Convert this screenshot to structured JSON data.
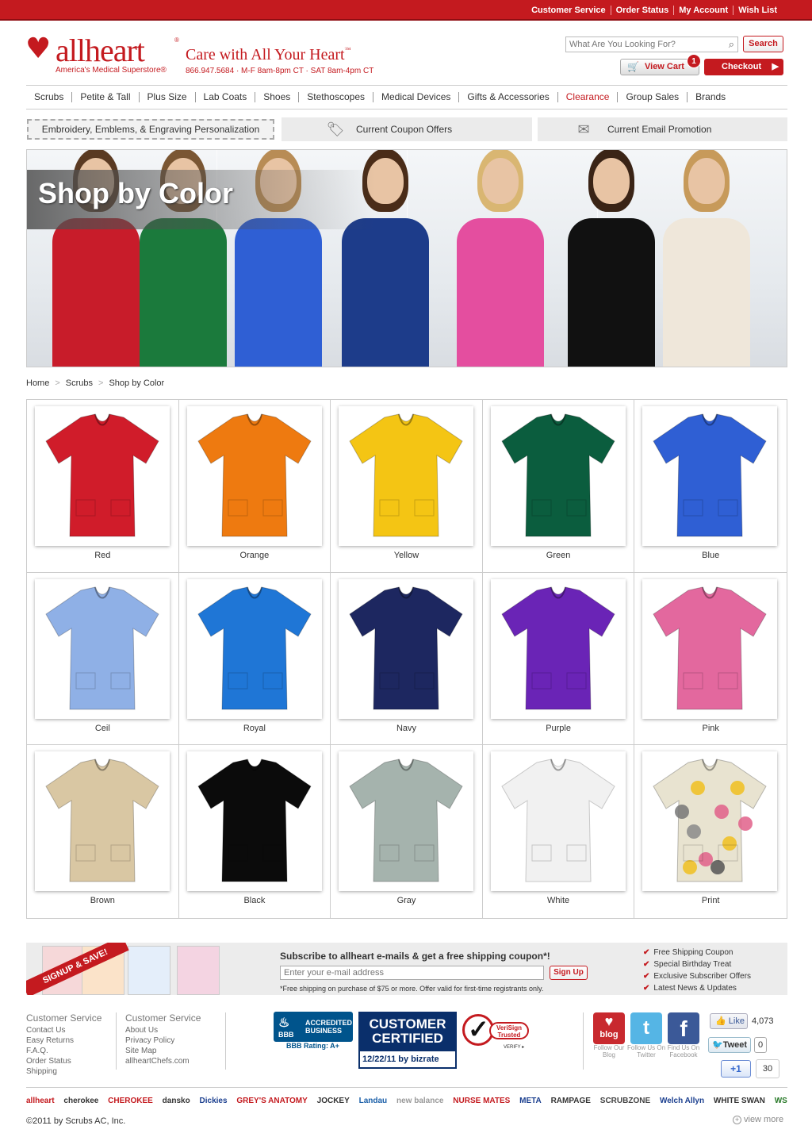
{
  "top_links": [
    "Customer Service",
    "Order Status",
    "My Account",
    "Wish List"
  ],
  "brand": {
    "name": "allheart",
    "reg": "®",
    "subtitle": "America's Medical Superstore",
    "reg2": "®",
    "tagline": "Care with All Your Heart",
    "tm": "™",
    "phone": "866.947.5684 · M-F 8am-8pm CT · SAT 8am-4pm CT"
  },
  "search": {
    "placeholder": "What Are You Looking For?",
    "button": "Search"
  },
  "cart": {
    "label": "View Cart",
    "count": "1",
    "checkout": "Checkout"
  },
  "nav": [
    "Scrubs",
    "Petite & Tall",
    "Plus Size",
    "Lab Coats",
    "Shoes",
    "Stethoscopes",
    "Medical Devices",
    "Gifts & Accessories",
    "Clearance",
    "Group Sales",
    "Brands"
  ],
  "promos": {
    "embroidery": "Embroidery, Emblems, & Engraving Personalization",
    "coupon": "Current Coupon Offers",
    "email": "Current Email Promotion"
  },
  "hero": {
    "title": "Shop by Color"
  },
  "breadcrumb": [
    "Home",
    "Scrubs",
    "Shop by Color"
  ],
  "colors": [
    {
      "name": "Red",
      "hex": "#d01c2a"
    },
    {
      "name": "Orange",
      "hex": "#ee7a10"
    },
    {
      "name": "Yellow",
      "hex": "#f4c514"
    },
    {
      "name": "Green",
      "hex": "#0b5d3e"
    },
    {
      "name": "Blue",
      "hex": "#2f5fd4"
    },
    {
      "name": "Ceil",
      "hex": "#8fb0e6"
    },
    {
      "name": "Royal",
      "hex": "#1f76d6"
    },
    {
      "name": "Navy",
      "hex": "#1d2760"
    },
    {
      "name": "Purple",
      "hex": "#6a24b6"
    },
    {
      "name": "Pink",
      "hex": "#e3689e"
    },
    {
      "name": "Brown",
      "hex": "#d9c7a3"
    },
    {
      "name": "Black",
      "hex": "#0b0b0b"
    },
    {
      "name": "Gray",
      "hex": "#a5b3ad"
    },
    {
      "name": "White",
      "hex": "#f1f1f1"
    },
    {
      "name": "Print",
      "hex": "#e8e3d0"
    }
  ],
  "newsletter": {
    "banner": "SIGNUP & SAVE!",
    "title": "Subscribe to allheart e-mails & get a free shipping coupon*!",
    "placeholder": "Enter your e-mail address",
    "button": "Sign Up",
    "fine_print": "*Free shipping on purchase of $75 or more. Offer valid for first-time registrants only.",
    "benefits": [
      "Free Shipping Coupon",
      "Special Birthday Treat",
      "Exclusive Subscriber Offers",
      "Latest News & Updates"
    ]
  },
  "footer": {
    "col1": {
      "title": "Customer Service",
      "links": [
        "Contact Us",
        "Easy Returns",
        "F.A.Q.",
        "Order Status",
        "Shipping"
      ]
    },
    "col2": {
      "title": "Customer Service",
      "links": [
        "About Us",
        "Privacy Policy",
        "Site Map",
        "allheartChefs.com"
      ]
    },
    "bbb": {
      "mark": "BBB",
      "accredited": "ACCREDITED BUSINESS",
      "rating": "BBB Rating: A+"
    },
    "certified": {
      "title": "CUSTOMER CERTIFIED",
      "date": "12/22/11 by bizrate"
    },
    "verisign": {
      "name": "VeriSign Trusted",
      "verify": "VERIFY ▸"
    },
    "social": [
      {
        "name": "blog",
        "caption": "Follow Our Blog"
      },
      {
        "name": "twitter",
        "caption": "Follow Us On Twitter"
      },
      {
        "name": "facebook",
        "caption": "Find Us On Facebook"
      }
    ],
    "like_label": "Like",
    "like_count": "4,073",
    "tweet_label": "Tweet",
    "tweet_count": "0",
    "plus_label": "+1",
    "plus_count": "30",
    "brands": [
      "allheart",
      "cherokee",
      "CHEROKEE",
      "dansko",
      "Dickies",
      "GREY'S ANATOMY",
      "JOCKEY",
      "Landau",
      "new balance",
      "NURSE MATES",
      "META",
      "RAMPAGE",
      "SCRUBZONE",
      "Welch Allyn",
      "WHITE SWAN",
      "WS"
    ],
    "copyright": "©2011 by Scrubs AC, Inc.",
    "view_more": "view more"
  }
}
